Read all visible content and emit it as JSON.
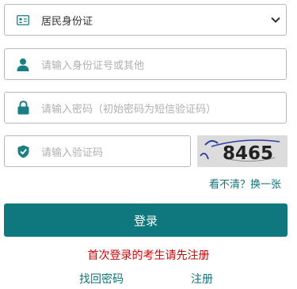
{
  "id_type": {
    "selected": "居民身份证"
  },
  "id_number": {
    "placeholder": "请输入身份证号或其他"
  },
  "password": {
    "placeholder": "请输入密码（初始密码为短信验证码）"
  },
  "captcha": {
    "placeholder": "请输入验证码",
    "image_text": "8465",
    "refresh_label": "看不清？换一张"
  },
  "login_button": "登录",
  "notice": "首次登录的考生请先注册",
  "links": {
    "recover": "找回密码",
    "register": "注册"
  },
  "colors": {
    "primary": "#0f777e",
    "link": "#12737a",
    "notice": "#d40000",
    "icon": "#1a7f84"
  }
}
